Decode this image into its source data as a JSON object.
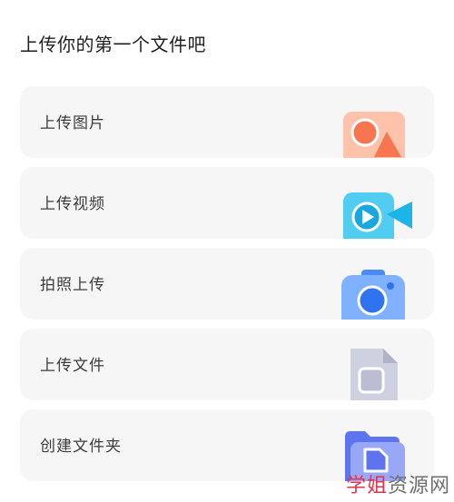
{
  "page": {
    "title": "上传你的第一个文件吧"
  },
  "options": [
    {
      "label": "上传图片",
      "icon": "image-icon"
    },
    {
      "label": "上传视频",
      "icon": "video-icon"
    },
    {
      "label": "拍照上传",
      "icon": "camera-icon"
    },
    {
      "label": "上传文件",
      "icon": "file-icon"
    },
    {
      "label": "创建文件夹",
      "icon": "folder-icon"
    }
  ],
  "watermark": {
    "part_a": "学姐",
    "part_b": "资源网"
  },
  "colors": {
    "card_bg": "#f6f6f7",
    "image_bg": "#ffc5ae",
    "image_accent": "#f7764f",
    "video_bg": "#48c6ee",
    "camera_bg": "#6aa5ff",
    "file_bg": "#c7c8da",
    "folder_bg": "#6d82f0"
  }
}
